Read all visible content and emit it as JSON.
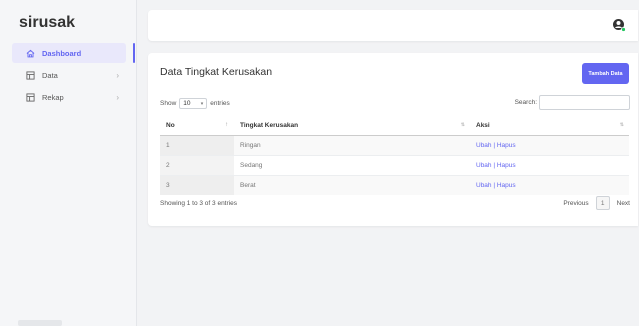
{
  "app": {
    "brand": "sirusak"
  },
  "sidebar": {
    "items": [
      {
        "label": "Dashboard",
        "icon": "home-icon",
        "active": true
      },
      {
        "label": "Data",
        "icon": "table-icon",
        "has_children": true
      },
      {
        "label": "Rekap",
        "icon": "table-icon",
        "has_children": true
      }
    ]
  },
  "header": {
    "user_icon": "user-circle-icon",
    "status_color": "#22c55e"
  },
  "card": {
    "title": "Data Tingkat Kerusakan",
    "add_button": "Tambah Data",
    "show_label": "Show",
    "entries_value": "10",
    "entries_label": "entries",
    "search_label": "Search:",
    "search_value": "",
    "columns": [
      "No",
      "Tingkat Kerusakan",
      "Aksi"
    ],
    "rows": [
      {
        "no": "1",
        "tingkat": "Ringan",
        "ubah": "Ubah",
        "sep": " | ",
        "hapus": "Hapus"
      },
      {
        "no": "2",
        "tingkat": "Sedang",
        "ubah": "Ubah",
        "sep": " | ",
        "hapus": "Hapus"
      },
      {
        "no": "3",
        "tingkat": "Berat",
        "ubah": "Ubah",
        "sep": " | ",
        "hapus": "Hapus"
      }
    ],
    "info": "Showing 1 to 3 of 3 entries",
    "pagination": {
      "previous": "Previous",
      "current_page": "1",
      "next": "Next"
    }
  },
  "colors": {
    "accent": "#6366f1",
    "background": "#f2f3f5"
  }
}
